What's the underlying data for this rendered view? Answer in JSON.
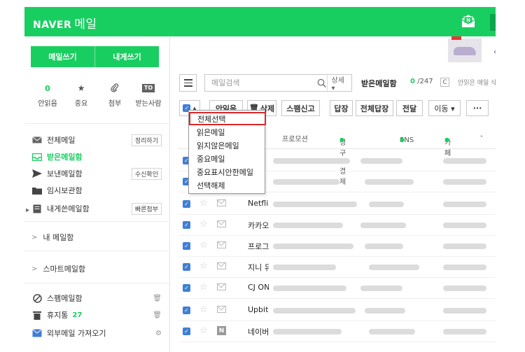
{
  "header": {
    "logo_brand": "NAVER",
    "logo_app": "메일"
  },
  "sidebar": {
    "write_button": "메일쓰기",
    "self_write_button": "내게쓰기",
    "quick": [
      {
        "top": "0",
        "label": "안읽음",
        "icon": "number"
      },
      {
        "top": "★",
        "label": "중요",
        "icon": "star-icon"
      },
      {
        "top": "📎",
        "label": "첨부",
        "icon": "paperclip-icon"
      },
      {
        "top": "TO",
        "label": "받는사람",
        "icon": "to-icon"
      }
    ],
    "folders": [
      {
        "label": "전체메일",
        "tag": "정리하기",
        "icon": "envelope-icon"
      },
      {
        "label": "받은메일함",
        "icon": "inbox-icon",
        "active": true
      },
      {
        "label": "보낸메일함",
        "tag": "수신확인",
        "icon": "send-icon"
      },
      {
        "label": "임시보관함",
        "icon": "folder-icon"
      },
      {
        "label": "내게쓴메일함",
        "tag": "빠른첨부",
        "icon": "self-mail-icon"
      }
    ],
    "my_mailbox": "내 메일함",
    "smart_mailbox": "스마트메일함",
    "spam": "스팸메일함",
    "trash": "휴지통",
    "trash_count": "27",
    "external": "외부메일 가져오기"
  },
  "search": {
    "placeholder": "메일검색",
    "detail": "상세 ▾"
  },
  "folder": {
    "title": "받은메일함",
    "unread": "0",
    "total": "/247",
    "refresh": "C",
    "unread_msg": "안읽은 메일 삭제"
  },
  "toolbar": {
    "read": "안읽음",
    "delete": "삭제",
    "spam": "스팸신고",
    "reply": "답장",
    "reply_all": "전체답장",
    "forward": "전달",
    "move": "이동 ▾",
    "more": "···"
  },
  "tabs": [
    "프로모션",
    "청구·결제",
    "SNS",
    "카페"
  ],
  "dropdown": [
    "전체선택",
    "읽은메일",
    "읽지않은메일",
    "중요메일",
    "중요표시안한메일",
    "선택해제"
  ],
  "rows": [
    {
      "sender": ""
    },
    {
      "sender": ""
    },
    {
      "sender": "Netflix"
    },
    {
      "sender": "카카오"
    },
    {
      "sender": "프로그"
    },
    {
      "sender": "지니 뮤"
    },
    {
      "sender": "CJ ON"
    },
    {
      "sender": "Upbit"
    },
    {
      "sender": "네이버"
    }
  ],
  "colors": {
    "naver_green": "#19ce60",
    "checkbox_blue": "#3f7fd6",
    "highlight_red": "#d8282a"
  }
}
